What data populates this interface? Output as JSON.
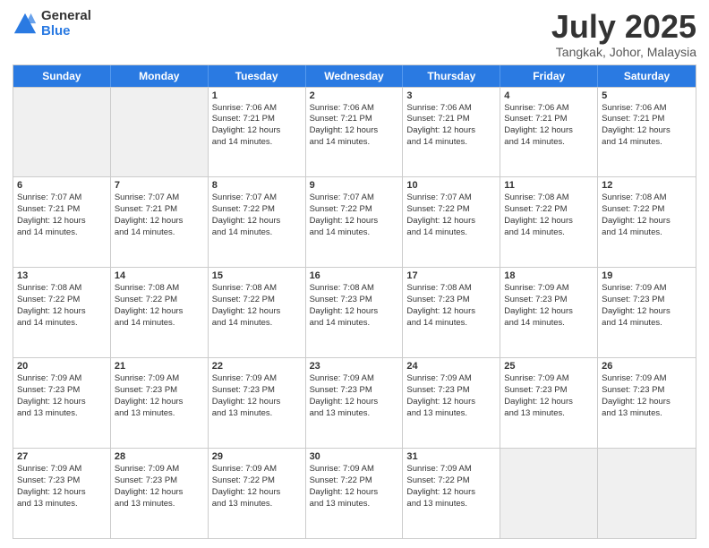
{
  "logo": {
    "general": "General",
    "blue": "Blue"
  },
  "header": {
    "month": "July 2025",
    "location": "Tangkak, Johor, Malaysia"
  },
  "days_of_week": [
    "Sunday",
    "Monday",
    "Tuesday",
    "Wednesday",
    "Thursday",
    "Friday",
    "Saturday"
  ],
  "weeks": [
    [
      {
        "day": "",
        "lines": [],
        "empty": true
      },
      {
        "day": "",
        "lines": [],
        "empty": true
      },
      {
        "day": "1",
        "lines": [
          "Sunrise: 7:06 AM",
          "Sunset: 7:21 PM",
          "Daylight: 12 hours",
          "and 14 minutes."
        ]
      },
      {
        "day": "2",
        "lines": [
          "Sunrise: 7:06 AM",
          "Sunset: 7:21 PM",
          "Daylight: 12 hours",
          "and 14 minutes."
        ]
      },
      {
        "day": "3",
        "lines": [
          "Sunrise: 7:06 AM",
          "Sunset: 7:21 PM",
          "Daylight: 12 hours",
          "and 14 minutes."
        ]
      },
      {
        "day": "4",
        "lines": [
          "Sunrise: 7:06 AM",
          "Sunset: 7:21 PM",
          "Daylight: 12 hours",
          "and 14 minutes."
        ]
      },
      {
        "day": "5",
        "lines": [
          "Sunrise: 7:06 AM",
          "Sunset: 7:21 PM",
          "Daylight: 12 hours",
          "and 14 minutes."
        ]
      }
    ],
    [
      {
        "day": "6",
        "lines": [
          "Sunrise: 7:07 AM",
          "Sunset: 7:21 PM",
          "Daylight: 12 hours",
          "and 14 minutes."
        ]
      },
      {
        "day": "7",
        "lines": [
          "Sunrise: 7:07 AM",
          "Sunset: 7:21 PM",
          "Daylight: 12 hours",
          "and 14 minutes."
        ]
      },
      {
        "day": "8",
        "lines": [
          "Sunrise: 7:07 AM",
          "Sunset: 7:22 PM",
          "Daylight: 12 hours",
          "and 14 minutes."
        ]
      },
      {
        "day": "9",
        "lines": [
          "Sunrise: 7:07 AM",
          "Sunset: 7:22 PM",
          "Daylight: 12 hours",
          "and 14 minutes."
        ]
      },
      {
        "day": "10",
        "lines": [
          "Sunrise: 7:07 AM",
          "Sunset: 7:22 PM",
          "Daylight: 12 hours",
          "and 14 minutes."
        ]
      },
      {
        "day": "11",
        "lines": [
          "Sunrise: 7:08 AM",
          "Sunset: 7:22 PM",
          "Daylight: 12 hours",
          "and 14 minutes."
        ]
      },
      {
        "day": "12",
        "lines": [
          "Sunrise: 7:08 AM",
          "Sunset: 7:22 PM",
          "Daylight: 12 hours",
          "and 14 minutes."
        ]
      }
    ],
    [
      {
        "day": "13",
        "lines": [
          "Sunrise: 7:08 AM",
          "Sunset: 7:22 PM",
          "Daylight: 12 hours",
          "and 14 minutes."
        ]
      },
      {
        "day": "14",
        "lines": [
          "Sunrise: 7:08 AM",
          "Sunset: 7:22 PM",
          "Daylight: 12 hours",
          "and 14 minutes."
        ]
      },
      {
        "day": "15",
        "lines": [
          "Sunrise: 7:08 AM",
          "Sunset: 7:22 PM",
          "Daylight: 12 hours",
          "and 14 minutes."
        ]
      },
      {
        "day": "16",
        "lines": [
          "Sunrise: 7:08 AM",
          "Sunset: 7:23 PM",
          "Daylight: 12 hours",
          "and 14 minutes."
        ]
      },
      {
        "day": "17",
        "lines": [
          "Sunrise: 7:08 AM",
          "Sunset: 7:23 PM",
          "Daylight: 12 hours",
          "and 14 minutes."
        ]
      },
      {
        "day": "18",
        "lines": [
          "Sunrise: 7:09 AM",
          "Sunset: 7:23 PM",
          "Daylight: 12 hours",
          "and 14 minutes."
        ]
      },
      {
        "day": "19",
        "lines": [
          "Sunrise: 7:09 AM",
          "Sunset: 7:23 PM",
          "Daylight: 12 hours",
          "and 14 minutes."
        ]
      }
    ],
    [
      {
        "day": "20",
        "lines": [
          "Sunrise: 7:09 AM",
          "Sunset: 7:23 PM",
          "Daylight: 12 hours",
          "and 13 minutes."
        ]
      },
      {
        "day": "21",
        "lines": [
          "Sunrise: 7:09 AM",
          "Sunset: 7:23 PM",
          "Daylight: 12 hours",
          "and 13 minutes."
        ]
      },
      {
        "day": "22",
        "lines": [
          "Sunrise: 7:09 AM",
          "Sunset: 7:23 PM",
          "Daylight: 12 hours",
          "and 13 minutes."
        ]
      },
      {
        "day": "23",
        "lines": [
          "Sunrise: 7:09 AM",
          "Sunset: 7:23 PM",
          "Daylight: 12 hours",
          "and 13 minutes."
        ]
      },
      {
        "day": "24",
        "lines": [
          "Sunrise: 7:09 AM",
          "Sunset: 7:23 PM",
          "Daylight: 12 hours",
          "and 13 minutes."
        ]
      },
      {
        "day": "25",
        "lines": [
          "Sunrise: 7:09 AM",
          "Sunset: 7:23 PM",
          "Daylight: 12 hours",
          "and 13 minutes."
        ]
      },
      {
        "day": "26",
        "lines": [
          "Sunrise: 7:09 AM",
          "Sunset: 7:23 PM",
          "Daylight: 12 hours",
          "and 13 minutes."
        ]
      }
    ],
    [
      {
        "day": "27",
        "lines": [
          "Sunrise: 7:09 AM",
          "Sunset: 7:23 PM",
          "Daylight: 12 hours",
          "and 13 minutes."
        ]
      },
      {
        "day": "28",
        "lines": [
          "Sunrise: 7:09 AM",
          "Sunset: 7:23 PM",
          "Daylight: 12 hours",
          "and 13 minutes."
        ]
      },
      {
        "day": "29",
        "lines": [
          "Sunrise: 7:09 AM",
          "Sunset: 7:22 PM",
          "Daylight: 12 hours",
          "and 13 minutes."
        ]
      },
      {
        "day": "30",
        "lines": [
          "Sunrise: 7:09 AM",
          "Sunset: 7:22 PM",
          "Daylight: 12 hours",
          "and 13 minutes."
        ]
      },
      {
        "day": "31",
        "lines": [
          "Sunrise: 7:09 AM",
          "Sunset: 7:22 PM",
          "Daylight: 12 hours",
          "and 13 minutes."
        ]
      },
      {
        "day": "",
        "lines": [],
        "empty": true
      },
      {
        "day": "",
        "lines": [],
        "empty": true
      }
    ]
  ]
}
